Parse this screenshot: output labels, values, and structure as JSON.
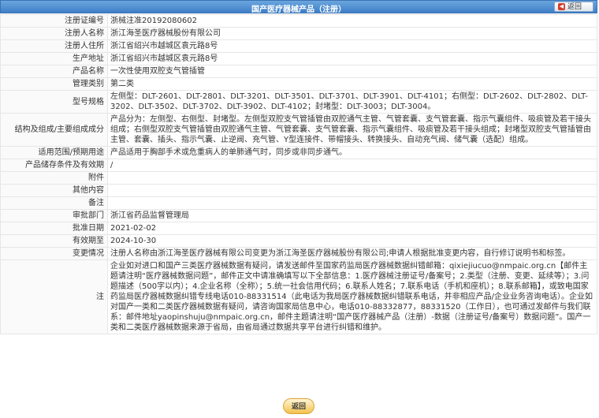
{
  "header": {
    "title": "国产医疗器械产品（注册）",
    "back_label": "返回"
  },
  "rows": [
    {
      "label": "注册证编号",
      "value": "浙械注准20192080602"
    },
    {
      "label": "注册人名称",
      "value": "浙江海圣医疗器械股份有限公司"
    },
    {
      "label": "注册人住所",
      "value": "浙江省绍兴市越城区袁元路8号"
    },
    {
      "label": "生产地址",
      "value": "浙江省绍兴市越城区袁元路8号"
    },
    {
      "label": "产品名称",
      "value": "一次性使用双腔支气管插管"
    },
    {
      "label": "管理类别",
      "value": "第二类"
    },
    {
      "label": "型号规格",
      "value": "左侧型：DLT-2601、DLT-2801、DLT-3201、DLT-3501、DLT-3701、DLT-3901、DLT-4101；右侧型：DLT-2602、DLT-2802、DLT-3202、DLT-3502、DLT-3702、DLT-3902、DLT-4102；封堵型：DLT-3003；DLT-3004。"
    },
    {
      "label": "结构及组成/主要组成成分",
      "value": "产品分为：左侧型、右侧型、封堵型。左侧型双腔支气管插管由双腔通气主管、气管套囊、支气管套囊、指示气囊组件、吸痰管及若干接头组成；右侧型双腔支气管插管由双腔通气主管、气管套囊、支气管套囊、指示气囊组件、吸痰管及若干接头组成；封堵型双腔支气管插管由主管、套囊、插头、指示气囊、止逆阀、充气管、Y型连接件、带帽接头、转换接头、自动充气阀、储气囊（选配）组成。"
    },
    {
      "label": "适用范围/预期用途",
      "value": "产品适用于胸部手术或危重病人的单肺通气时，同步或非同步通气。"
    },
    {
      "label": "产品储存条件及有效期",
      "value": "/"
    },
    {
      "label": "附件",
      "value": ""
    },
    {
      "label": "其他内容",
      "value": ""
    },
    {
      "label": "备注",
      "value": ""
    },
    {
      "label": "审批部门",
      "value": "浙江省药品监督管理局"
    },
    {
      "label": "批准日期",
      "value": "2021-02-02"
    },
    {
      "label": "有效期至",
      "value": "2024-10-30"
    },
    {
      "label": "变更情况",
      "value": "注册人名称由浙江海圣医疗器械有限公司变更为浙江海圣医疗器械股份有限公司;申请人根据批准变更内容，自行修订说明书和标签。"
    },
    {
      "label": "注",
      "value": "企业如对进口和国产三类医疗器械数据有疑问，请发送邮件至国家药监局医疗器械数据纠错邮箱：qixiejiucuo@nmpaic.org.cn【邮件主题请注明“医疗器械数据问题”，邮件正文中请准确填写以下全部信息：1.医疗器械注册证号/备案号；2.类型（注册、变更、延续等）；3.问题描述（500字以内）；4.企业名称（全称）；5.统一社会信用代码；6.联系人姓名；7.联系电话（手机和座机）；8.联系邮箱】，或致电国家药监局医疗器械数据纠错专线电话010-88331514（此电话为我局医疗器械数据纠错联系电话，并非相应产品/企业业务咨询电话）。企业如对国产一类和二类医疗器械数据有疑问，请咨询国家局信息中心，电话010-88332877，88331520（工作日），也可通过发邮件与我们联系：邮件地址yaopinshuju@nmpaic.org.cn，邮件主题请注明“国产医疗器械产品（注册）-数据（注册证号/备案号）数据问题”。国产一类和二类医疗器械数据来源于省局，由省局通过数据共享平台进行纠错和维护。"
    }
  ],
  "footer": {
    "back_label": "返回"
  }
}
